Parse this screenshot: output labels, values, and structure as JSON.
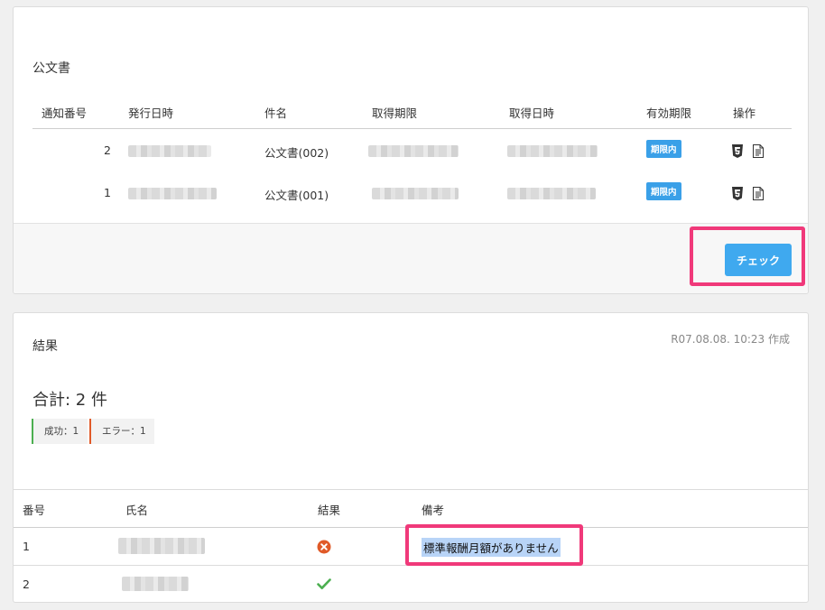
{
  "docs_card": {
    "title": "公文書",
    "columns": [
      "通知番号",
      "発行日時",
      "件名",
      "取得期限",
      "取得日時",
      "有効期限",
      "操作"
    ],
    "rows": [
      {
        "number": "2",
        "subject": "公文書(002)",
        "validity": "期限内"
      },
      {
        "number": "1",
        "subject": "公文書(001)",
        "validity": "期限内"
      }
    ],
    "op_icons": [
      "html5-icon",
      "document-icon"
    ],
    "check_button": "チェック",
    "accent": "#3fa9ef",
    "highlight_color": "#f0397a"
  },
  "results_card": {
    "title": "結果",
    "created": "R07.08.08. 10:23 作成",
    "total": "合計: 2 件",
    "stats": {
      "success": "成功：1",
      "error": "エラー：1"
    },
    "columns": [
      "番号",
      "氏名",
      "結果",
      "備考"
    ],
    "rows": [
      {
        "number": "1",
        "result": "error",
        "remark": "標準報酬月額がありません"
      },
      {
        "number": "2",
        "result": "success",
        "remark": ""
      }
    ],
    "success_color": "#4caf50",
    "error_color": "#e05a28"
  }
}
